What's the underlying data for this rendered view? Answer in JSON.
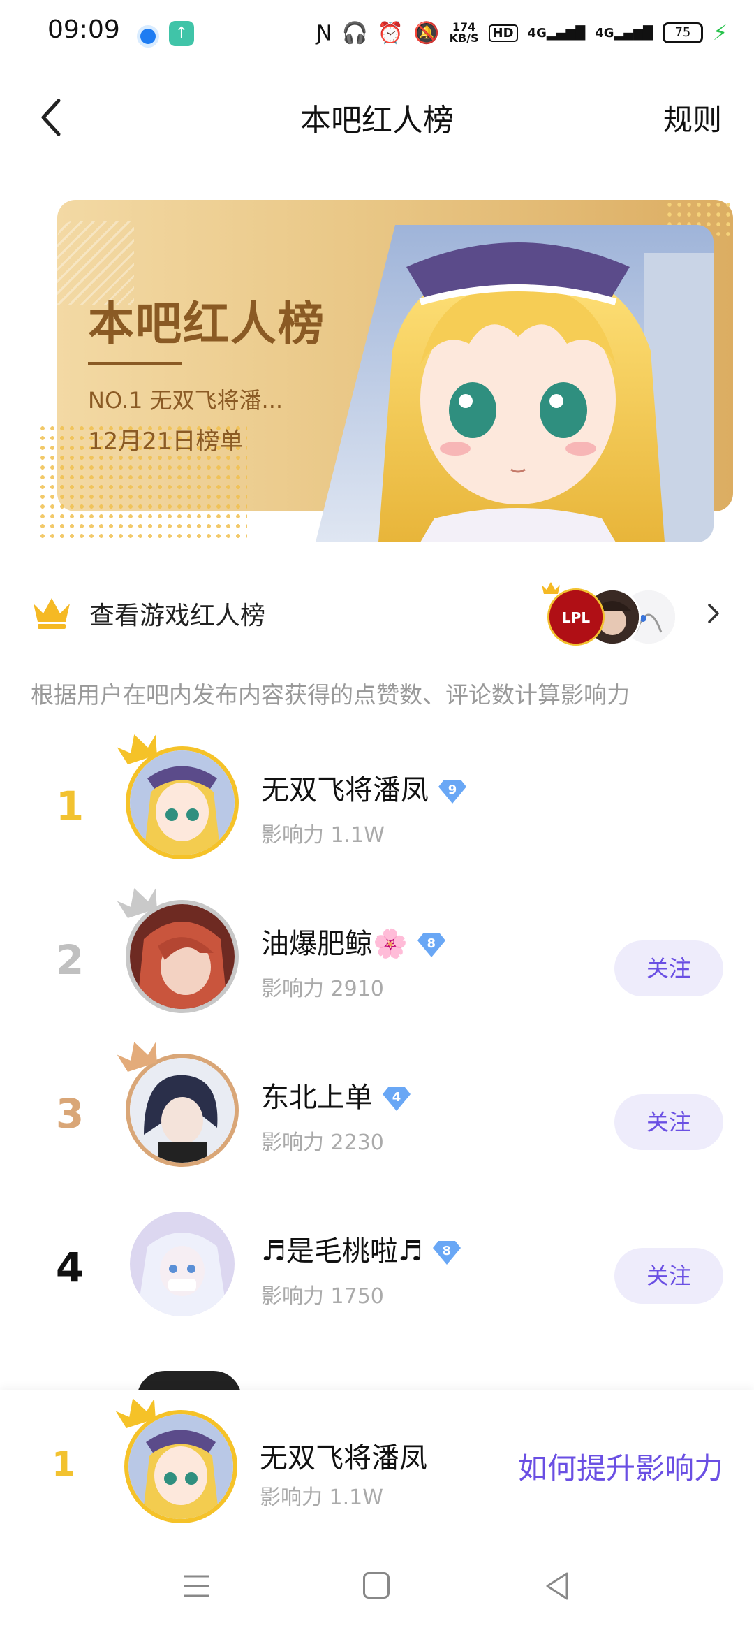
{
  "status": {
    "time": "09:09",
    "net_speed_top": "174",
    "net_speed_bottom": "KB/S",
    "hd": "HD",
    "signal1": "4G",
    "signal2": "4G",
    "battery": "75"
  },
  "header": {
    "title": "本吧红人榜",
    "rules": "规则"
  },
  "banner": {
    "title": "本吧红人榜",
    "no1": "NO.1  无双飞将潘...",
    "date": "12月21日榜单"
  },
  "game_row": {
    "label": "查看游戏红人榜"
  },
  "description": "根据用户在吧内发布内容获得的点赞数、评论数计算影响力",
  "ranking": [
    {
      "rank": "1",
      "name": "无双飞将潘凤",
      "level": "9",
      "influence": "影响力  1.1W",
      "follow": ""
    },
    {
      "rank": "2",
      "name": "油爆肥鲸🌸",
      "level": "8",
      "influence": "影响力  2910",
      "follow": "关注"
    },
    {
      "rank": "3",
      "name": "东北上单",
      "level": "4",
      "influence": "影响力  2230",
      "follow": "关注"
    },
    {
      "rank": "4",
      "name": "♬是毛桃啦♬",
      "level": "8",
      "influence": "影响力  1750",
      "follow": "关注"
    }
  ],
  "me": {
    "rank": "1",
    "name": "无双飞将潘凤",
    "influence": "影响力  1.1W",
    "boost": "如何提升影响力"
  },
  "colors": {
    "gold": "#f2c230",
    "silver": "#c0c0c0",
    "bronze": "#d9a677",
    "accent": "#6a4fe3",
    "banner_text": "#8a5a24"
  }
}
